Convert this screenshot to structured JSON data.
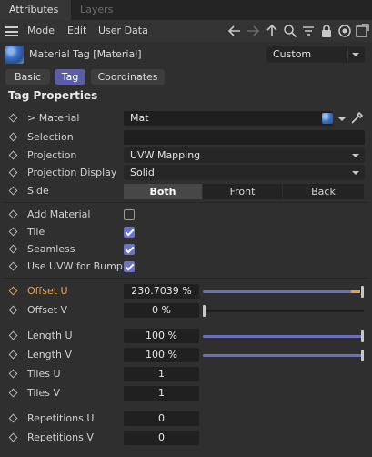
{
  "tabs": {
    "active": "Attributes",
    "inactive": "Layers"
  },
  "menu": {
    "mode": "Mode",
    "edit": "Edit",
    "user_data": "User Data"
  },
  "object": {
    "title": "Material Tag [Material]",
    "preset": "Custom"
  },
  "mode_tabs": [
    "Basic",
    "Tag",
    "Coordinates"
  ],
  "section_title": "Tag Properties",
  "properties": {
    "material": {
      "label": "> Material",
      "value": "Mat"
    },
    "selection": {
      "label": "Selection",
      "value": ""
    },
    "projection": {
      "label": "Projection",
      "value": "UVW Mapping"
    },
    "projection_display": {
      "label": "Projection Display",
      "value": "Solid"
    },
    "side": {
      "label": "Side",
      "options": [
        "Both",
        "Front",
        "Back"
      ],
      "selected": "Both"
    },
    "add_material": {
      "label": "Add Material",
      "checked": false
    },
    "tile": {
      "label": "Tile",
      "checked": true
    },
    "seamless": {
      "label": "Seamless",
      "checked": true
    },
    "use_uvw_bump": {
      "label": "Use UVW for Bump",
      "checked": true
    },
    "offset_u": {
      "label": "Offset U",
      "value": "230.7039 %",
      "slider": 0.99
    },
    "offset_v": {
      "label": "Offset V",
      "value": "0 %",
      "slider": 0.0
    },
    "length_u": {
      "label": "Length U",
      "value": "100 %",
      "slider": 1.0
    },
    "length_v": {
      "label": "Length V",
      "value": "100 %",
      "slider": 1.0
    },
    "tiles_u": {
      "label": "Tiles U",
      "value": "1"
    },
    "tiles_v": {
      "label": "Tiles V",
      "value": "1"
    },
    "repetitions_u": {
      "label": "Repetitions U",
      "value": "0"
    },
    "repetitions_v": {
      "label": "Repetitions V",
      "value": "0"
    }
  },
  "colors": {
    "accent": "#6d72c9",
    "background": "#2f2f2f",
    "highlight": "#e8a64a"
  }
}
